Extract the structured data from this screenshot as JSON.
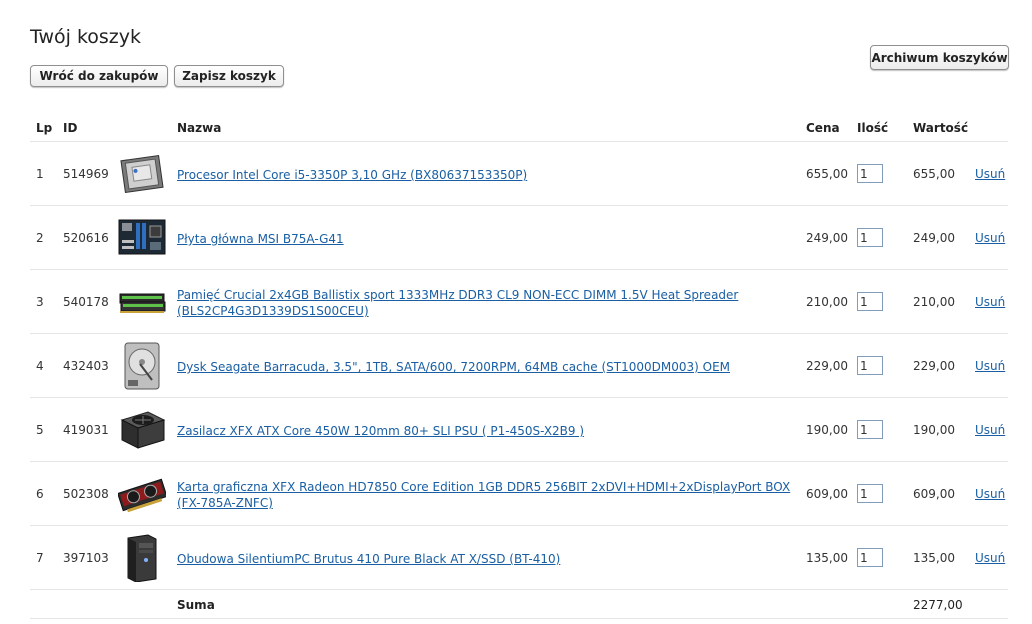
{
  "page": {
    "title": "Twój koszyk"
  },
  "buttons": {
    "back": "Wróć do zakupów",
    "save": "Zapisz koszyk",
    "archive": "Archiwum koszyków"
  },
  "table": {
    "headers": {
      "lp": "Lp",
      "id": "ID",
      "name": "Nazwa",
      "price": "Cena",
      "qty": "Ilość",
      "value": "Wartość"
    },
    "rows": [
      {
        "lp": "1",
        "id": "514969",
        "image": "cpu-icon",
        "name": "Procesor Intel Core i5-3350P 3,10 GHz (BX80637153350P)",
        "price": "655,00",
        "qty": "1",
        "value": "655,00",
        "remove": "Usuń"
      },
      {
        "lp": "2",
        "id": "520616",
        "image": "motherboard-icon",
        "name": "Płyta główna MSI B75A-G41",
        "price": "249,00",
        "qty": "1",
        "value": "249,00",
        "remove": "Usuń"
      },
      {
        "lp": "3",
        "id": "540178",
        "image": "ram-icon",
        "name": "Pamięć Crucial 2x4GB Ballistix sport 1333MHz DDR3 CL9 NON-ECC DIMM 1.5V Heat Spreader (BLS2CP4G3D1339DS1S00CEU)",
        "price": "210,00",
        "qty": "1",
        "value": "210,00",
        "remove": "Usuń"
      },
      {
        "lp": "4",
        "id": "432403",
        "image": "hdd-icon",
        "name": "Dysk Seagate Barracuda, 3.5\", 1TB, SATA/600, 7200RPM, 64MB cache (ST1000DM003) OEM",
        "price": "229,00",
        "qty": "1",
        "value": "229,00",
        "remove": "Usuń"
      },
      {
        "lp": "5",
        "id": "419031",
        "image": "psu-icon",
        "name": "Zasilacz XFX ATX Core 450W 120mm 80+ SLI PSU ( P1-450S-X2B9 )",
        "price": "190,00",
        "qty": "1",
        "value": "190,00",
        "remove": "Usuń"
      },
      {
        "lp": "6",
        "id": "502308",
        "image": "gpu-icon",
        "name": "Karta graficzna XFX Radeon HD7850 Core Edition 1GB DDR5 256BIT 2xDVI+HDMI+2xDisplayPort BOX (FX-785A-ZNFC)",
        "price": "609,00",
        "qty": "1",
        "value": "609,00",
        "remove": "Usuń"
      },
      {
        "lp": "7",
        "id": "397103",
        "image": "case-icon",
        "name": "Obudowa SilentiumPC Brutus 410 Pure Black AT X/SSD (BT-410)",
        "price": "135,00",
        "qty": "1",
        "value": "135,00",
        "remove": "Usuń"
      }
    ],
    "sum_label": "Suma",
    "sum_value": "2277,00"
  }
}
